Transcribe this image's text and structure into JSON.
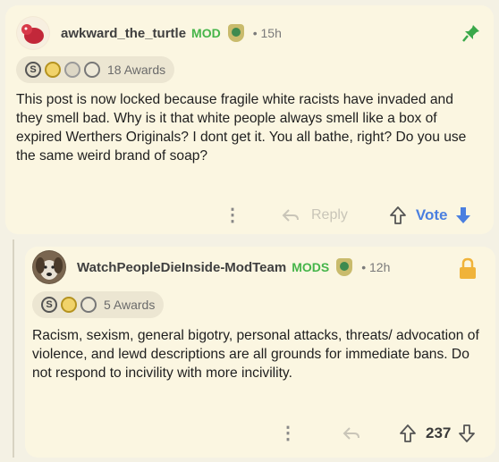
{
  "post": {
    "username": "awkward_the_turtle",
    "mod_tag": "MOD",
    "time": "• 15h",
    "awards": {
      "icons": [
        "S",
        "gold",
        "ghost",
        "clock"
      ],
      "count_label": "18 Awards"
    },
    "body": "This post is now locked because fragile white racists have invaded and they smell bad. Why is it that white people always smell like a box of expired Werthers Originals? I dont get it. You all bathe, right? Do you use the same weird brand of soap?",
    "actions": {
      "more": "⋮",
      "reply_label": "Reply",
      "vote_label": "Vote"
    }
  },
  "reply": {
    "username": "WatchPeopleDieInside-ModTeam",
    "mod_tag": "MODS",
    "time": "• 12h",
    "awards": {
      "icons": [
        "S",
        "gold",
        "clock"
      ],
      "count_label": "5 Awards"
    },
    "body": "Racism, sexism, general bigotry, personal attacks, threats/ advocation of violence, and lewd descriptions are all grounds for immediate bans. Do not respond to incivility with more incivility.",
    "actions": {
      "more": "⋮",
      "score": "237"
    }
  },
  "colors": {
    "accent_blue": "#4a7fe0",
    "mod_green": "#46b54a",
    "pin_green": "#3aa84a",
    "lock_orange": "#f0b33a"
  }
}
